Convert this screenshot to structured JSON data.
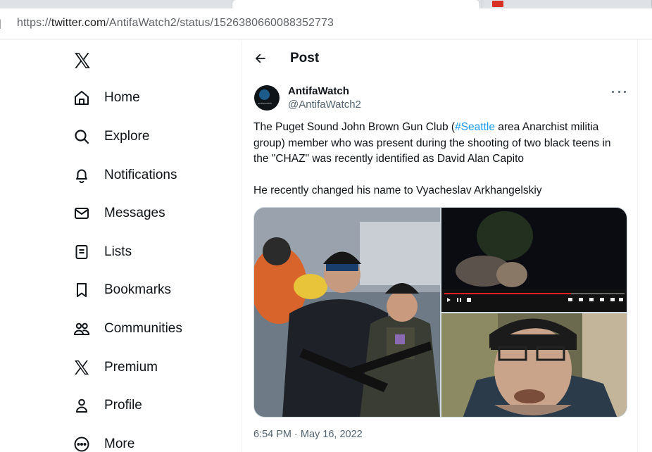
{
  "browser": {
    "url_scheme": "https://",
    "url_host": "twitter.com",
    "url_path": "/AntifaWatch2/status/1526380660088352773",
    "left_glyph": "]"
  },
  "nav": {
    "items": [
      {
        "label": "Home",
        "icon": "home-icon"
      },
      {
        "label": "Explore",
        "icon": "search-icon"
      },
      {
        "label": "Notifications",
        "icon": "bell-icon"
      },
      {
        "label": "Messages",
        "icon": "envelope-icon"
      },
      {
        "label": "Lists",
        "icon": "list-icon"
      },
      {
        "label": "Bookmarks",
        "icon": "bookmark-icon"
      },
      {
        "label": "Communities",
        "icon": "people-icon"
      },
      {
        "label": "Premium",
        "icon": "x-logo-icon"
      },
      {
        "label": "Profile",
        "icon": "person-icon"
      },
      {
        "label": "More",
        "icon": "more-circle-icon"
      }
    ]
  },
  "header": {
    "title": "Post"
  },
  "tweet": {
    "author_name": "AntifaWatch",
    "author_handle": "@AntifaWatch2",
    "avatar_text": "antifawatch",
    "text_line1_pre": "The Puget Sound John Brown Gun Club (",
    "hashtag": "#Seattle",
    "text_line1_post": " area Anarchist militia group) member who was present during the shooting of two black teens in the \"CHAZ\" was recently identified as David Alan Capito",
    "text_line2": "He recently changed his name to Vyacheslav Arkhangelskiy",
    "timestamp": "6:54 PM · May 16, 2022"
  },
  "colors": {
    "accent": "#1d9bf0",
    "text_primary": "#0f1419",
    "text_secondary": "#536471",
    "border": "#eff3f4"
  }
}
